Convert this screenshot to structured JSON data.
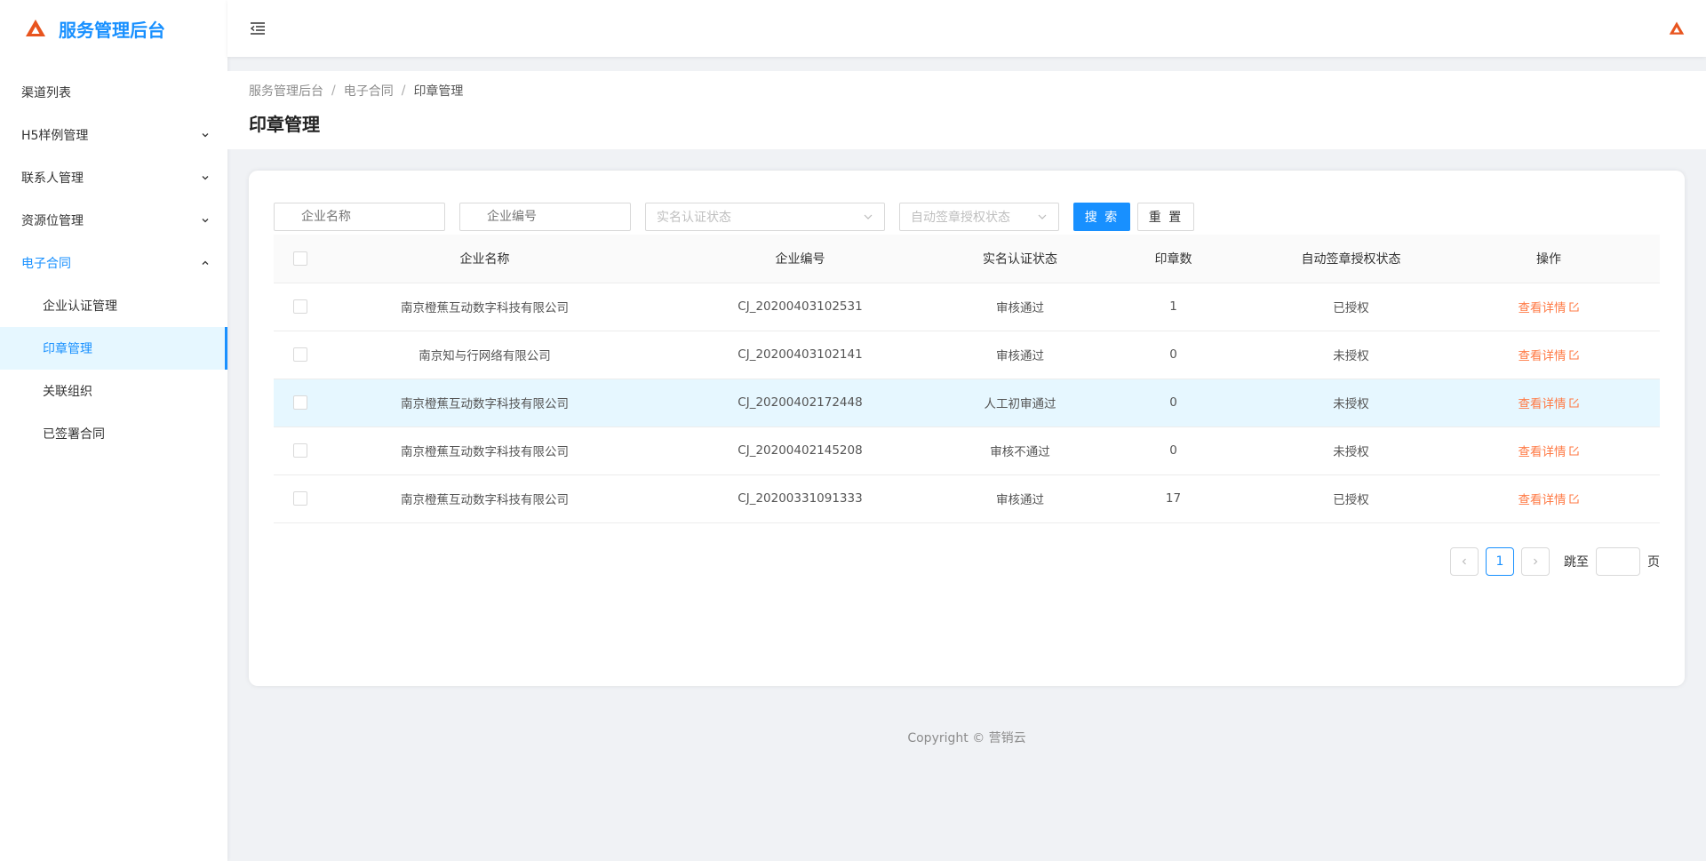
{
  "app": {
    "title": "服务管理后台"
  },
  "sidebar": {
    "items": [
      {
        "label": "渠道列表"
      },
      {
        "label": "H5样例管理"
      },
      {
        "label": "联系人管理"
      },
      {
        "label": "资源位管理"
      },
      {
        "label": "电子合同"
      },
      {
        "label": "企业认证管理"
      },
      {
        "label": "印章管理"
      },
      {
        "label": "关联组织"
      },
      {
        "label": "已签署合同"
      }
    ]
  },
  "breadcrumb": [
    "服务管理后台",
    "电子合同",
    "印章管理"
  ],
  "breadcrumb_sep": "/",
  "page_title": "印章管理",
  "filters": {
    "company_name_placeholder": "企业名称",
    "company_no_placeholder": "企业编号",
    "auth_status_placeholder": "实名认证状态",
    "auto_sign_placeholder": "自动签章授权状态",
    "search_label": "搜 索",
    "reset_label": "重 置"
  },
  "table": {
    "columns": [
      "企业名称",
      "企业编号",
      "实名认证状态",
      "印章数",
      "自动签章授权状态",
      "操作"
    ],
    "rows": [
      {
        "name": "南京橙蕉互动数字科技有限公司",
        "no": "CJ_20200403102531",
        "auth": "审核通过",
        "seals": "1",
        "auto": "已授权",
        "action": "查看详情"
      },
      {
        "name": "南京知与行网络有限公司",
        "no": "CJ_20200403102141",
        "auth": "审核通过",
        "seals": "0",
        "auto": "未授权",
        "action": "查看详情"
      },
      {
        "name": "南京橙蕉互动数字科技有限公司",
        "no": "CJ_20200402172448",
        "auth": "人工初审通过",
        "seals": "0",
        "auto": "未授权",
        "action": "查看详情"
      },
      {
        "name": "南京橙蕉互动数字科技有限公司",
        "no": "CJ_20200402145208",
        "auth": "审核不通过",
        "seals": "0",
        "auto": "未授权",
        "action": "查看详情"
      },
      {
        "name": "南京橙蕉互动数字科技有限公司",
        "no": "CJ_20200331091333",
        "auth": "审核通过",
        "seals": "17",
        "auto": "已授权",
        "action": "查看详情"
      }
    ]
  },
  "pagination": {
    "current": "1",
    "jump_label": "跳至",
    "page_label": "页"
  },
  "footer": "Copyright © 营销云",
  "colors": {
    "primary": "#1890ff",
    "action": "#ff7a45",
    "logo": "#e8541e"
  }
}
